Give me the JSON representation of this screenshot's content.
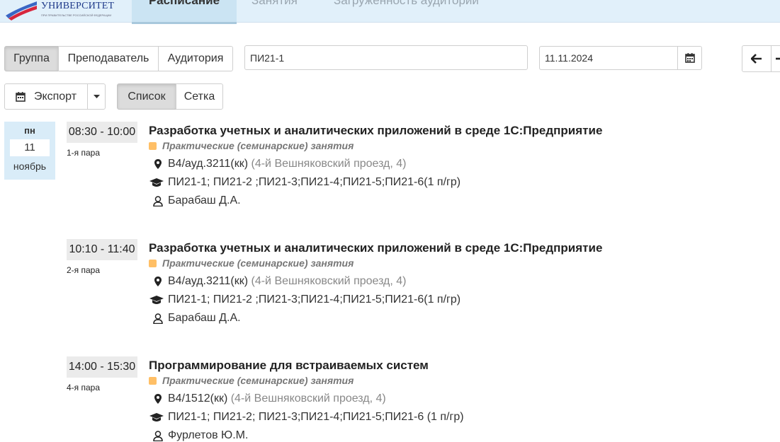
{
  "header": {
    "logo_main": "УНИВЕРСИТЕТ",
    "logo_sub": "ПРИ ПРАВИТЕЛЬСТВЕ РОССИЙСКОЙ ФЕДЕРАЦИИ",
    "nav": [
      {
        "label": "Расписание",
        "active": true
      },
      {
        "label": "Занятия",
        "active": false
      },
      {
        "label": "Загруженность аудиторий",
        "active": false
      }
    ]
  },
  "toolbar": {
    "mode_buttons": [
      "Группа",
      "Преподаватель",
      "Аудитория"
    ],
    "active_mode": "Группа",
    "group_value": "ПИ21-1",
    "date_value": "11.11.2024",
    "export_label": "Экспорт",
    "view_buttons": [
      "Список",
      "Сетка"
    ],
    "active_view": "Список"
  },
  "day": {
    "dow": "пн",
    "num": "11",
    "month": "ноябрь"
  },
  "lessons": [
    {
      "time": "08:30 - 10:00",
      "para": "1-я пара",
      "title": "Разработка учетных и аналитических приложений в среде 1С:Предприятие",
      "type": "Практические (семинарские) занятия",
      "room": "В4/ауд.3211(кк)",
      "address": "(4-й Вешняковский проезд, 4)",
      "groups": "ПИ21-1; ПИ21-2 ;ПИ21-3;ПИ21-4;ПИ21-5;ПИ21-6(1 п/гр)",
      "teacher": "Барабаш Д.А."
    },
    {
      "time": "10:10 - 11:40",
      "para": "2-я пара",
      "title": "Разработка учетных и аналитических приложений в среде 1С:Предприятие",
      "type": "Практические (семинарские) занятия",
      "room": "В4/ауд.3211(кк)",
      "address": "(4-й Вешняковский проезд, 4)",
      "groups": "ПИ21-1; ПИ21-2 ;ПИ21-3;ПИ21-4;ПИ21-5;ПИ21-6(1 п/гр)",
      "teacher": "Барабаш Д.А."
    },
    {
      "time": "14:00 - 15:30",
      "para": "4-я пара",
      "title": "Программирование для встраиваемых систем",
      "type": "Практические (семинарские) занятия",
      "room": "В4/1512(кк)",
      "address": "(4-й Вешняковский проезд, 4)",
      "groups": "ПИ21-1; ПИ21-2; ПИ21-3;ПИ21-4;ПИ21-5;ПИ21-6 (1 п/гр)",
      "teacher": "Фурлетов Ю.М."
    }
  ],
  "icons": {
    "calendar": "calendar-icon",
    "caret": "caret-down-icon",
    "arrow": "arrow-left-icon",
    "location": "map-marker-icon",
    "groups": "graduation-cap-icon",
    "teacher": "user-icon"
  },
  "colors": {
    "type_marker": "#ffbf66",
    "day_bg": "#d9ecf8",
    "topbar_bg": "#e1f0fa"
  }
}
